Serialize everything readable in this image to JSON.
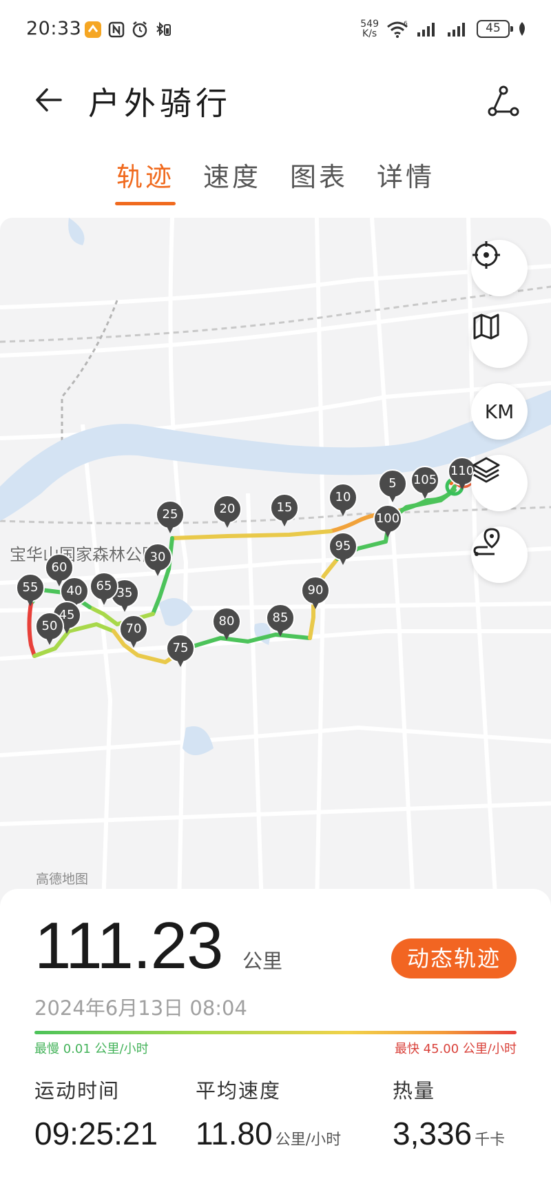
{
  "status_bar": {
    "time": "20:33",
    "net_speed_value": "549",
    "net_speed_unit": "K/s",
    "network_type": "6",
    "battery": "45"
  },
  "header": {
    "title": "户外骑行"
  },
  "tabs": [
    {
      "label": "轨迹",
      "active": true
    },
    {
      "label": "速度",
      "active": false
    },
    {
      "label": "图表",
      "active": false
    },
    {
      "label": "详情",
      "active": false
    }
  ],
  "map": {
    "watermark": "高德地图",
    "place_label": "宝华山国家森林公园",
    "km_button": "KM",
    "km_markers": [
      "5",
      "10",
      "15",
      "20",
      "25",
      "30",
      "35",
      "40",
      "45",
      "50",
      "55",
      "60",
      "65",
      "70",
      "75",
      "80",
      "85",
      "90",
      "95",
      "100",
      "105",
      "110"
    ]
  },
  "summary": {
    "distance": "111.23",
    "distance_unit": "公里",
    "replay_button": "动态轨迹",
    "date": "2024年6月13日 08:04",
    "slowest": "最慢 0.01 公里/小时",
    "fastest": "最快 45.00 公里/小时"
  },
  "stats": [
    {
      "label": "运动时间",
      "value": "09:25:21",
      "unit": ""
    },
    {
      "label": "平均速度",
      "value": "11.80",
      "unit": "公里/小时"
    },
    {
      "label": "热量",
      "value": "3,336",
      "unit": "千卡"
    }
  ],
  "colors": {
    "accent": "#f06a1e",
    "button": "#f26522",
    "slow": "#4cc35a",
    "fast": "#e8403a"
  }
}
